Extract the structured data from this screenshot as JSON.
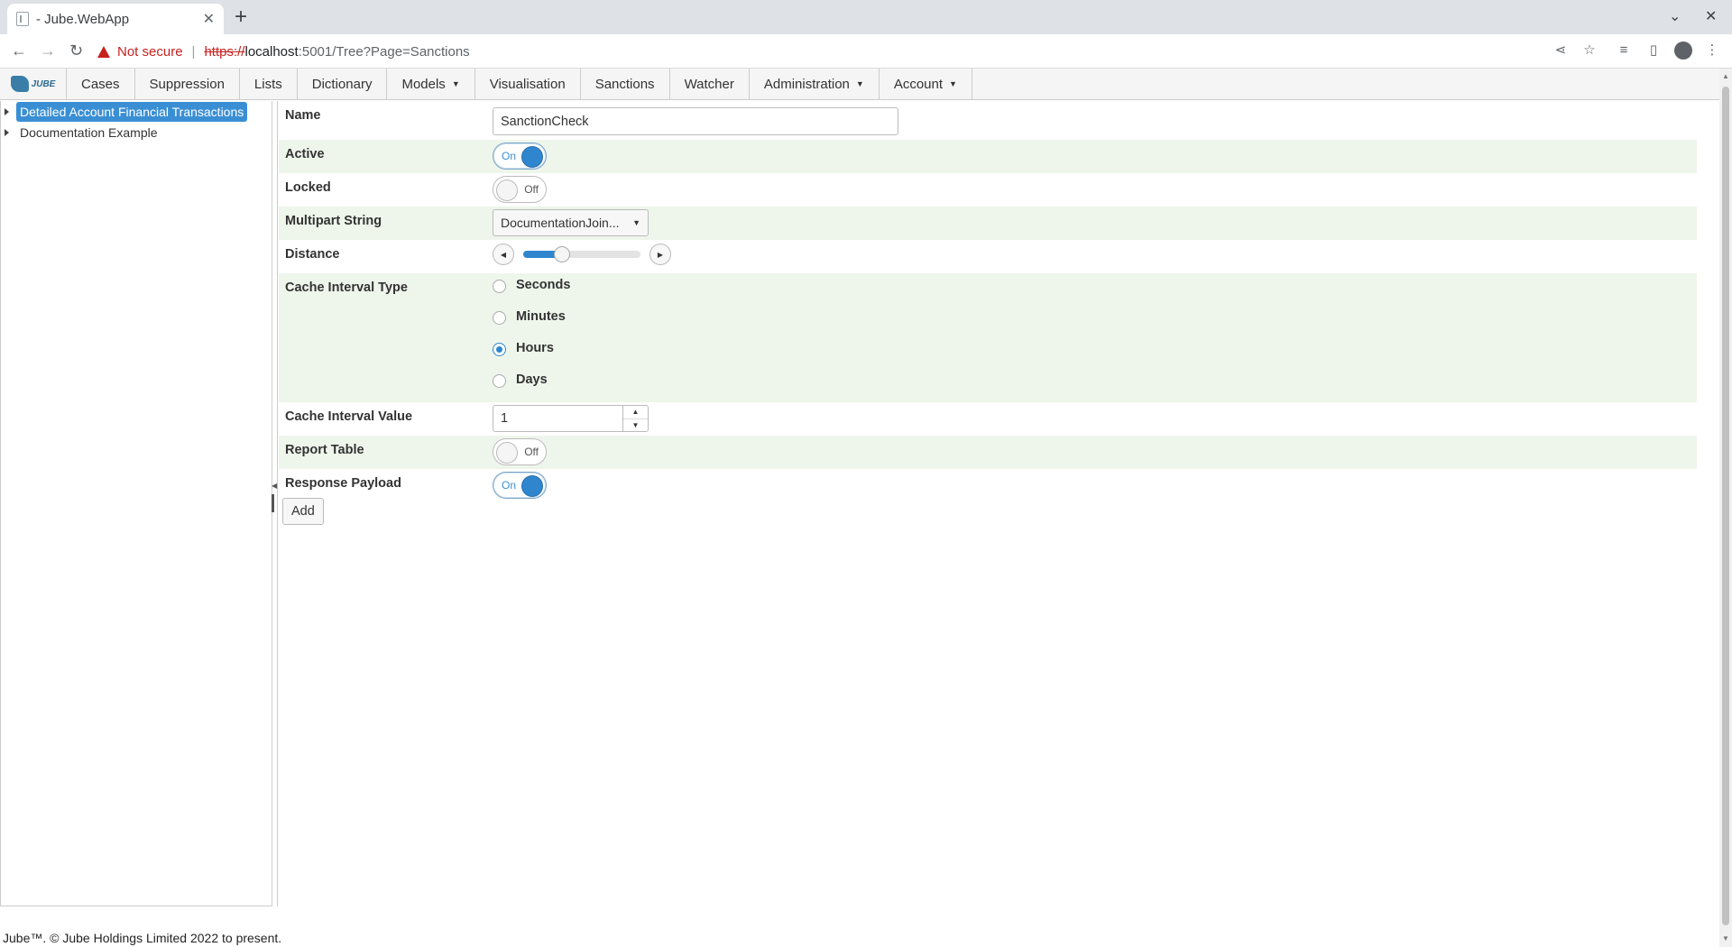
{
  "browser": {
    "tab_title": "- Jube.WebApp",
    "tab_close": "✕",
    "new_tab": "+",
    "not_secure": "Not secure",
    "url_scheme": "https://",
    "url_host": "localhost",
    "url_path": ":5001/Tree?Page=Sanctions"
  },
  "nav": {
    "logo_text": "JUBE",
    "items": [
      {
        "label": "Cases",
        "dropdown": false
      },
      {
        "label": "Suppression",
        "dropdown": false
      },
      {
        "label": "Lists",
        "dropdown": false
      },
      {
        "label": "Dictionary",
        "dropdown": false
      },
      {
        "label": "Models",
        "dropdown": true
      },
      {
        "label": "Visualisation",
        "dropdown": false
      },
      {
        "label": "Sanctions",
        "dropdown": false
      },
      {
        "label": "Watcher",
        "dropdown": false
      },
      {
        "label": "Administration",
        "dropdown": true
      },
      {
        "label": "Account",
        "dropdown": true
      }
    ]
  },
  "tree": {
    "items": [
      {
        "label": "Detailed Account Financial Transactions",
        "selected": true
      },
      {
        "label": "Documentation Example",
        "selected": false
      }
    ]
  },
  "form": {
    "name_label": "Name",
    "name_value": "SanctionCheck",
    "active_label": "Active",
    "active_state": "On",
    "locked_label": "Locked",
    "locked_state": "Off",
    "multipart_label": "Multipart String",
    "multipart_value": "DocumentationJoin...",
    "distance_label": "Distance",
    "distance_fraction": 0.33,
    "cache_type_label": "Cache Interval Type",
    "cache_type_options": [
      "Seconds",
      "Minutes",
      "Hours",
      "Days"
    ],
    "cache_type_selected": "Hours",
    "cache_value_label": "Cache Interval Value",
    "cache_value": "1",
    "report_table_label": "Report Table",
    "report_table_state": "Off",
    "response_payload_label": "Response Payload",
    "response_payload_state": "On",
    "add_label": "Add"
  },
  "footer": {
    "text": "Jube™. © Jube Holdings Limited 2022 to present."
  },
  "colors": {
    "accent": "#2f86cf",
    "alt_row": "#eef6ec",
    "not_secure": "#c5221f"
  }
}
